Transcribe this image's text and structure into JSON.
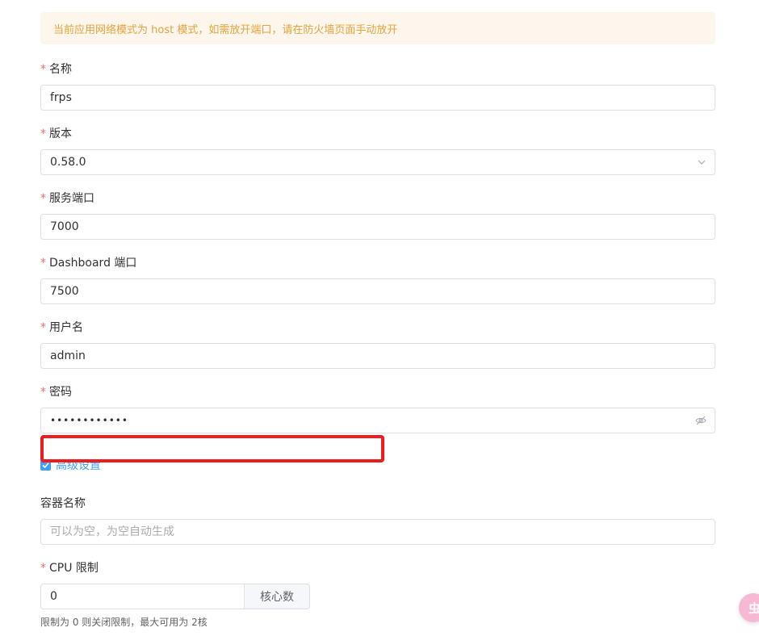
{
  "alert": {
    "text": "当前应用网络模式为 host 模式，如需放开端口，请在防火墙页面手动放开"
  },
  "form": {
    "name": {
      "label": "名称",
      "value": "frps"
    },
    "version": {
      "label": "版本",
      "value": "0.58.0",
      "icon": "chevron-down-icon"
    },
    "service_port": {
      "label": "服务端口",
      "value": "7000"
    },
    "dashboard_port": {
      "label": "Dashboard 端口",
      "value": "7500"
    },
    "username": {
      "label": "用户名",
      "value": "admin"
    },
    "password": {
      "label": "密码",
      "value": "••••••••••••",
      "icon": "eye-off-icon"
    },
    "advanced": {
      "label": "高级设置",
      "checked": true
    },
    "container_name": {
      "label": "容器名称",
      "placeholder": "可以为空，为空自动生成"
    },
    "cpu_limit": {
      "label": "CPU 限制",
      "value": "0",
      "unit": "核心数",
      "help": "限制为 0 则关闭限制，最大可用为 2核"
    }
  },
  "floating_button": {
    "text": "虫"
  },
  "colors": {
    "required": "#f56c6c",
    "primary": "#409eff",
    "warning": "#e6a23c",
    "annotation": "#ee1c1c"
  }
}
